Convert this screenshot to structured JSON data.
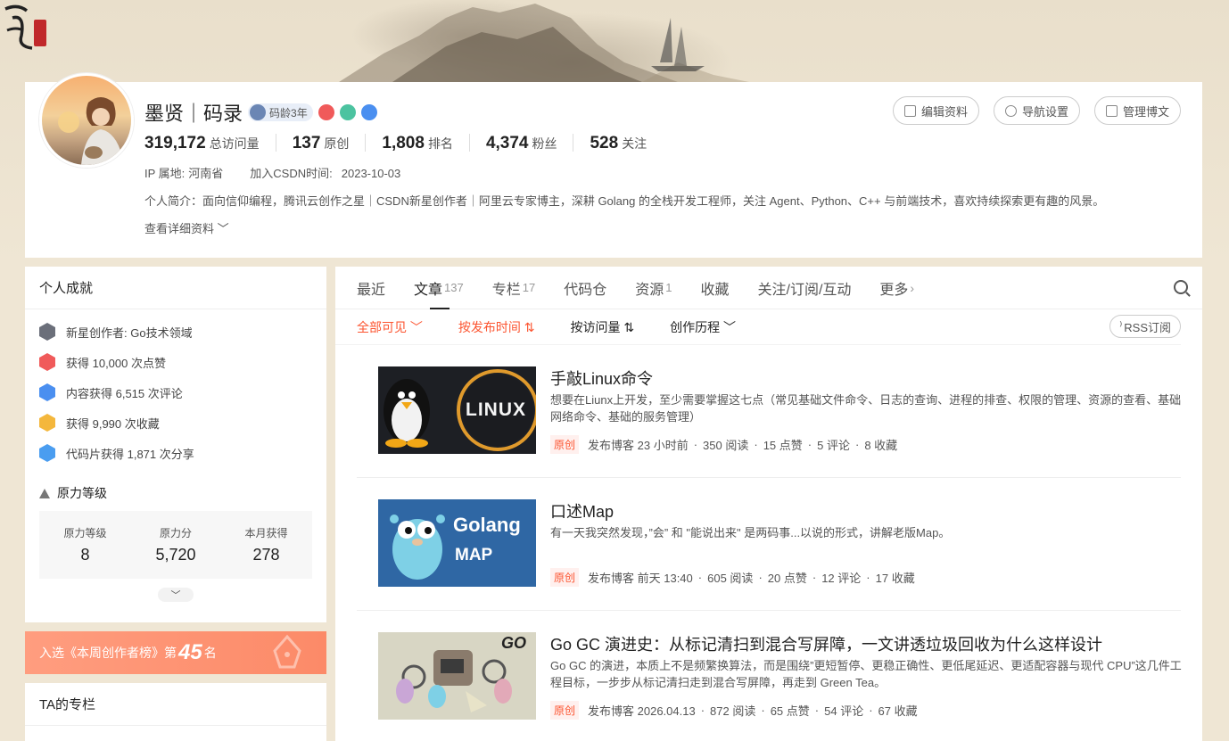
{
  "profile": {
    "name": "墨贤｜码录",
    "age_badge": "码龄3年",
    "stats": [
      {
        "num": "319,172",
        "label": "总访问量"
      },
      {
        "num": "137",
        "label": "原创"
      },
      {
        "num": "1,808",
        "label": "排名"
      },
      {
        "num": "4,374",
        "label": "粉丝"
      },
      {
        "num": "528",
        "label": "关注"
      }
    ],
    "ip_label": "IP 属地:",
    "ip_value": "河南省",
    "join_label": "加入CSDN时间:",
    "join_value": "2023-10-03",
    "intro": "个人简介：面向信仰编程，腾讯云创作之星｜CSDN新星创作者｜阿里云专家博主，深耕 Golang 的全栈开发工程师，关注 Agent、Python、C++ 与前端技术，喜欢持续探索更有趣的风景。",
    "more_detail": "查看详细资料",
    "buttons": {
      "edit": "编辑资料",
      "nav": "导航设置",
      "manage": "管理博文"
    }
  },
  "achievements": {
    "title": "个人成就",
    "items": [
      {
        "text": "新星创作者: Go技术领域",
        "color": "#6b6f7a"
      },
      {
        "text": "获得 10,000 次点赞",
        "color": "#f05a5a"
      },
      {
        "text": "内容获得 6,515 次评论",
        "color": "#4a8ff0"
      },
      {
        "text": "获得 9,990 次收藏",
        "color": "#f4b73c"
      },
      {
        "text": "代码片获得 1,871 次分享",
        "color": "#4a9df0"
      }
    ],
    "level_title": "原力等级",
    "levels": [
      {
        "label": "原力等级",
        "value": "8"
      },
      {
        "label": "原力分",
        "value": "5,720"
      },
      {
        "label": "本月获得",
        "value": "278"
      }
    ]
  },
  "rank": {
    "prefix": "入选《本周创作者榜》第",
    "num": "45",
    "suffix": "名"
  },
  "columns_card": {
    "title": "TA的专栏"
  },
  "tabs": [
    {
      "label": "最近",
      "count": ""
    },
    {
      "label": "文章",
      "count": "137"
    },
    {
      "label": "专栏",
      "count": "17"
    },
    {
      "label": "代码仓",
      "count": ""
    },
    {
      "label": "资源",
      "count": "1"
    },
    {
      "label": "收藏",
      "count": ""
    },
    {
      "label": "关注/订阅/互动",
      "count": ""
    },
    {
      "label": "更多",
      "count": ""
    }
  ],
  "filters": {
    "visibility": "全部可见",
    "by_time": "按发布时间 ⇅",
    "by_views": "按访问量 ⇅",
    "history": "创作历程",
    "rss": "RSS订阅"
  },
  "articles": [
    {
      "title": "手敲Linux命令",
      "desc": "想要在Liunx上开发，至少需要掌握这七点（常见基础文件命令、日志的查询、进程的排查、权限的管理、资源的查看、基础网络命令、基础的服务管理）",
      "tag": "原创",
      "time": "发布博客 23 小时前",
      "views": "350 阅读",
      "likes": "15 点赞",
      "comments": "5 评论",
      "favs": "8 收藏",
      "thumb_text": "LINUX"
    },
    {
      "title": "口述Map",
      "desc": "有一天我突然发现，”会” 和 \"能说出来\" 是两码事...以说的形式，讲解老版Map。",
      "tag": "原创",
      "time": "发布博客 前天 13:40",
      "views": "605 阅读",
      "likes": "20 点赞",
      "comments": "12 评论",
      "favs": "17 收藏",
      "thumb_text": "Golang",
      "thumb_sub": "MAP"
    },
    {
      "title": "Go GC 演进史：从标记清扫到混合写屏障，一文讲透垃圾回收为什么这样设计",
      "desc": "Go GC 的演进，本质上不是频繁换算法，而是围绕”更短暂停、更稳正确性、更低尾延迟、更适配容器与现代 CPU”这几件工程目标，一步步从标记清扫走到混合写屏障，再走到 Green Tea。",
      "tag": "原创",
      "time": "发布博客 2026.04.13",
      "views": "872 阅读",
      "likes": "65 点赞",
      "comments": "54 评论",
      "favs": "67 收藏",
      "thumb_text": "GO"
    }
  ]
}
